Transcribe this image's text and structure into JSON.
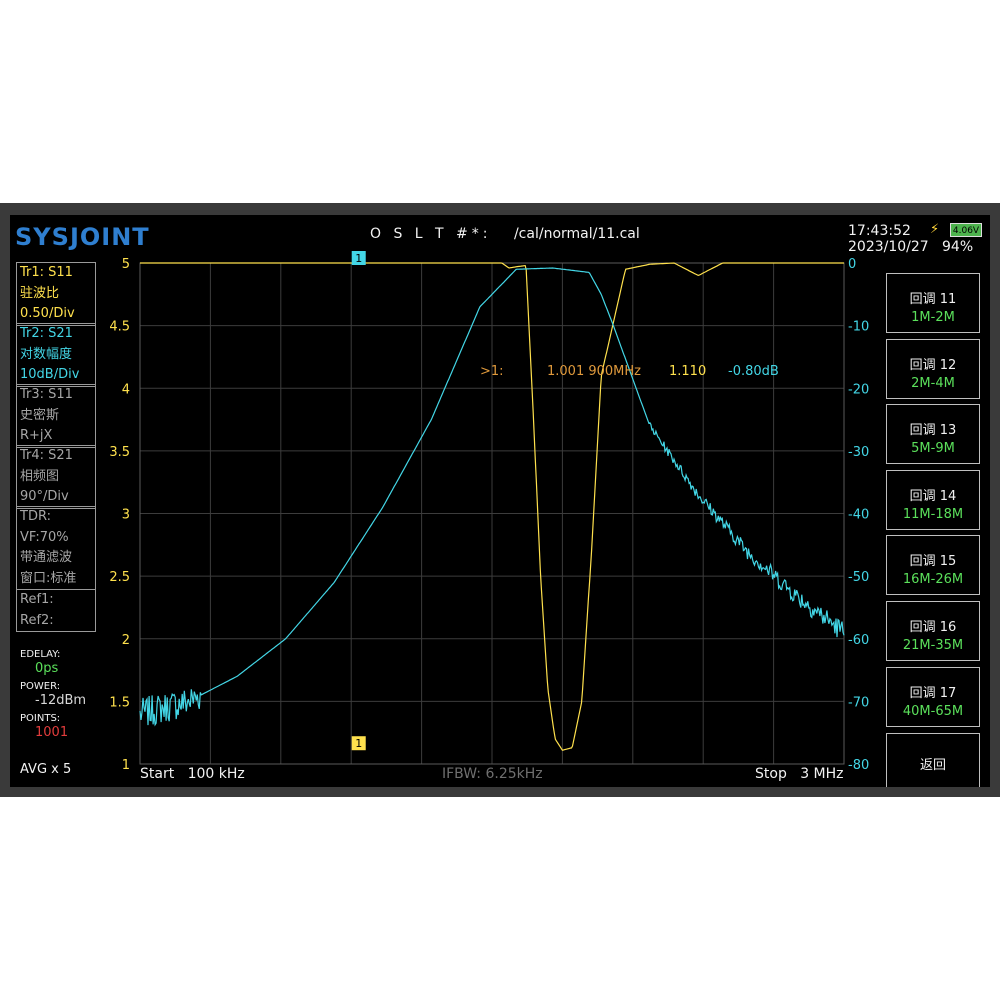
{
  "header": {
    "logo": "SYSJOINT",
    "cal_prefix": "O S L T #*:",
    "cal_path": "/cal/normal/11.cal",
    "time": "17:43:52",
    "date": "2023/10/27",
    "battery_voltage": "4.06V",
    "battery_percent": "94%"
  },
  "traces": [
    {
      "line1": "Tr1:   S11",
      "line2": "驻波比",
      "line3": "0.50/Div",
      "color": "#ffe14d"
    },
    {
      "line1": "Tr2:   S21",
      "line2": "对数幅度",
      "line3": "10dB/Div",
      "color": "#43d6e6"
    },
    {
      "line1": "Tr3:   S11",
      "line2": "史密斯",
      "line3": "R+jX",
      "color": "#a6a6a6"
    },
    {
      "line1": "Tr4:   S21",
      "line2": "相频图",
      "line3": "90°/Div",
      "color": "#a6a6a6"
    }
  ],
  "tdr": {
    "line1": "TDR:",
    "line2": "VF:70%",
    "line3": "带通滤波",
    "line4": "窗口:标准"
  },
  "refs": {
    "ref1": "Ref1:",
    "ref2": "Ref2:"
  },
  "settings": {
    "edelay_label": "EDELAY:",
    "edelay_value": "0ps",
    "power_label": "POWER:",
    "power_value": "-12dBm",
    "points_label": "POINTS:",
    "points_value": "1001",
    "avg": "AVG x 5"
  },
  "marker": {
    "label": ">1:",
    "frequency": "1.001 900MHz",
    "swr": "1.110",
    "db": "-0.80dB",
    "badge": "1"
  },
  "footer": {
    "start_label": "Start",
    "start_value": "100 kHz",
    "ifbw": "IFBW: 6.25kHz",
    "stop_label": "Stop",
    "stop_value": "3 MHz"
  },
  "buttons": [
    {
      "label": "回调 11",
      "range": "1M-2M"
    },
    {
      "label": "回调 12",
      "range": "2M-4M"
    },
    {
      "label": "回调 13",
      "range": "5M-9M"
    },
    {
      "label": "回调 14",
      "range": "11M-18M"
    },
    {
      "label": "回调 15",
      "range": "16M-26M"
    },
    {
      "label": "回调 16",
      "range": "21M-35M"
    },
    {
      "label": "回调 17",
      "range": "40M-65M"
    },
    {
      "label": "返回",
      "range": ""
    }
  ],
  "chart_data": {
    "type": "line",
    "x_range_mhz": [
      0.1,
      3.0
    ],
    "left_axis": {
      "ticks": [
        "5",
        "4.5",
        "4",
        "3.5",
        "3",
        "2.5",
        "2",
        "1.5",
        "1"
      ],
      "range": [
        1,
        5
      ]
    },
    "right_axis": {
      "ticks": [
        "0",
        "-10",
        "-20",
        "-30",
        "-40",
        "-50",
        "-60",
        "-70",
        "-80"
      ],
      "range": [
        -80,
        0
      ]
    },
    "grid": true,
    "series": [
      {
        "color": "#ffe14d",
        "axis": "left",
        "x": [
          0.1,
          1.59,
          1.62,
          1.65,
          1.69,
          1.72,
          1.75,
          1.78,
          1.81,
          1.84,
          1.88,
          1.92,
          1.96,
          2.0,
          2.1,
          2.2,
          2.3,
          2.4,
          2.5,
          3.0
        ],
        "y": [
          5,
          5,
          4.96,
          4.97,
          4.98,
          3.8,
          2.5,
          1.6,
          1.2,
          1.11,
          1.13,
          1.5,
          2.7,
          4.1,
          4.95,
          4.99,
          5,
          4.9,
          5,
          5
        ]
      },
      {
        "color": "#43d6e6",
        "axis": "right",
        "x": [
          0.1,
          0.3,
          0.5,
          0.7,
          0.9,
          1.1,
          1.3,
          1.5,
          1.65,
          1.8,
          1.95,
          2.0,
          2.05,
          2.2,
          2.4,
          2.6,
          2.8,
          3.0
        ],
        "y": [
          -72,
          -70,
          -66,
          -60,
          -51,
          -39,
          -25,
          -7,
          -1,
          -0.8,
          -1.5,
          -5,
          -10,
          -26,
          -37,
          -46,
          -53,
          -59
        ]
      }
    ]
  }
}
